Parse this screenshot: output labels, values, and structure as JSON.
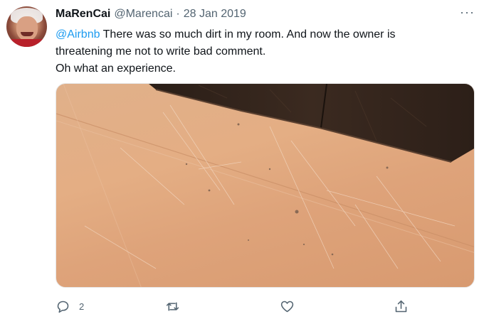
{
  "tweet": {
    "author_name": "MaRenCai",
    "author_handle": "@Marencai",
    "separator": "·",
    "date": "28 Jan 2019",
    "mention": "@Airbnb",
    "line1_rest": " There was so much dirt in my room. And now the owner is",
    "line2": "threatening me not to write bad comment.",
    "line3": "Oh what an experience.",
    "more_label": "···"
  },
  "actions": {
    "reply_count": "2",
    "icons": [
      "reply-icon",
      "retweet-icon",
      "like-icon",
      "share-icon"
    ],
    "icon_color": "#536471"
  },
  "colors": {
    "accent": "#1d9bf0",
    "text": "#0f1419",
    "muted": "#536471"
  }
}
